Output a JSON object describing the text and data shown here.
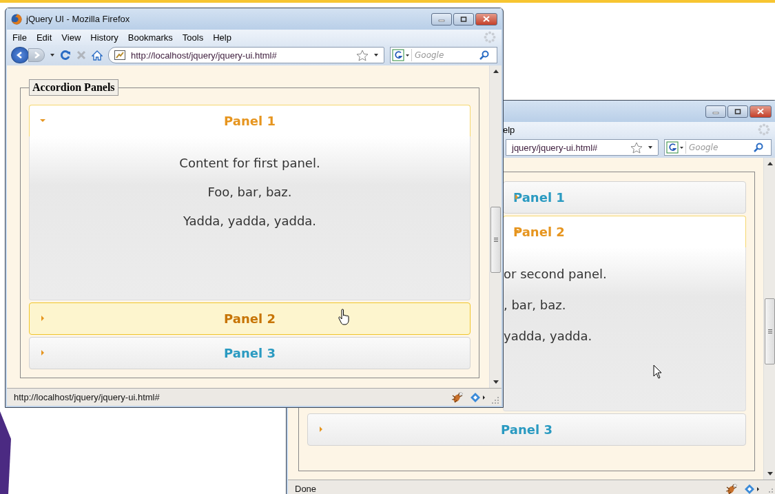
{
  "windows": [
    {
      "title": "jQuery UI - Mozilla Firefox",
      "menu": [
        "File",
        "Edit",
        "View",
        "History",
        "Bookmarks",
        "Tools",
        "Help"
      ],
      "address": "http://localhost/jquery/jquery-ui.html#",
      "search": {
        "placeholder": "Google"
      },
      "legend": "Accordion Panels",
      "panels": [
        {
          "title": "Panel 1",
          "expanded": true,
          "hovered": false,
          "content": [
            "Content for first panel.",
            "Foo, bar, baz.",
            "Yadda, yadda, yadda."
          ]
        },
        {
          "title": "Panel 2",
          "expanded": false,
          "hovered": true
        },
        {
          "title": "Panel 3",
          "expanded": false,
          "hovered": false
        }
      ],
      "status": "http://localhost/jquery/jquery-ui.html#"
    },
    {
      "menu": [
        "elp"
      ],
      "address": "jquery/jquery-ui.html#",
      "search": {
        "placeholder": "Google"
      },
      "panels": [
        {
          "title": "Panel 1",
          "expanded": false,
          "hovered": false
        },
        {
          "title": "Panel 2",
          "expanded": true,
          "hovered": false,
          "content": [
            "or second panel.",
            ", bar, baz.",
            "yadda, yadda."
          ]
        },
        {
          "title": "Panel 3",
          "expanded": false,
          "hovered": false
        }
      ],
      "status": "Done"
    }
  ]
}
